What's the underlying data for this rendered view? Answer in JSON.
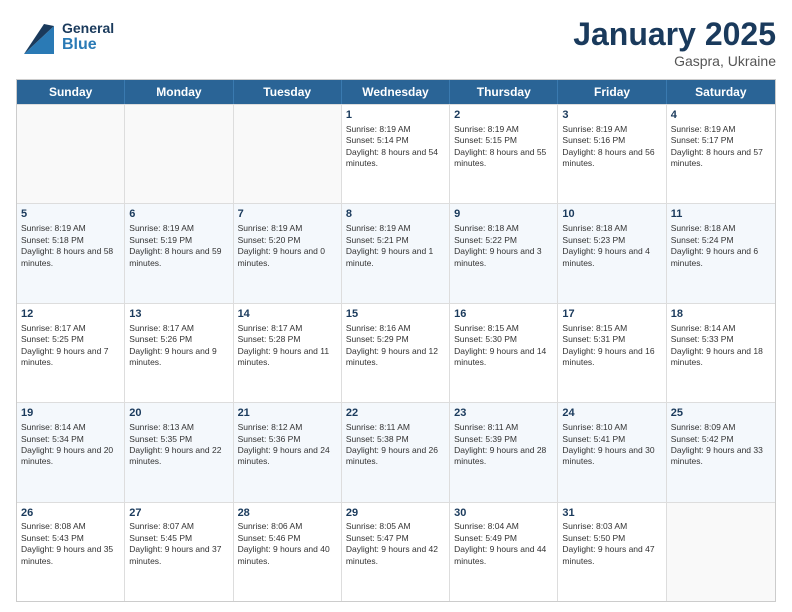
{
  "header": {
    "logo_general": "General",
    "logo_blue": "Blue",
    "month_title": "January 2025",
    "location": "Gaspra, Ukraine"
  },
  "days_of_week": [
    "Sunday",
    "Monday",
    "Tuesday",
    "Wednesday",
    "Thursday",
    "Friday",
    "Saturday"
  ],
  "weeks": [
    {
      "days": [
        {
          "number": "",
          "empty": true
        },
        {
          "number": "",
          "empty": true
        },
        {
          "number": "",
          "empty": true
        },
        {
          "number": "1",
          "sunrise": "8:19 AM",
          "sunset": "5:14 PM",
          "daylight": "8 hours and 54 minutes."
        },
        {
          "number": "2",
          "sunrise": "8:19 AM",
          "sunset": "5:15 PM",
          "daylight": "8 hours and 55 minutes."
        },
        {
          "number": "3",
          "sunrise": "8:19 AM",
          "sunset": "5:16 PM",
          "daylight": "8 hours and 56 minutes."
        },
        {
          "number": "4",
          "sunrise": "8:19 AM",
          "sunset": "5:17 PM",
          "daylight": "8 hours and 57 minutes."
        }
      ]
    },
    {
      "days": [
        {
          "number": "5",
          "sunrise": "8:19 AM",
          "sunset": "5:18 PM",
          "daylight": "8 hours and 58 minutes."
        },
        {
          "number": "6",
          "sunrise": "8:19 AM",
          "sunset": "5:19 PM",
          "daylight": "8 hours and 59 minutes."
        },
        {
          "number": "7",
          "sunrise": "8:19 AM",
          "sunset": "5:20 PM",
          "daylight": "9 hours and 0 minutes."
        },
        {
          "number": "8",
          "sunrise": "8:19 AM",
          "sunset": "5:21 PM",
          "daylight": "9 hours and 1 minute."
        },
        {
          "number": "9",
          "sunrise": "8:18 AM",
          "sunset": "5:22 PM",
          "daylight": "9 hours and 3 minutes."
        },
        {
          "number": "10",
          "sunrise": "8:18 AM",
          "sunset": "5:23 PM",
          "daylight": "9 hours and 4 minutes."
        },
        {
          "number": "11",
          "sunrise": "8:18 AM",
          "sunset": "5:24 PM",
          "daylight": "9 hours and 6 minutes."
        }
      ]
    },
    {
      "days": [
        {
          "number": "12",
          "sunrise": "8:17 AM",
          "sunset": "5:25 PM",
          "daylight": "9 hours and 7 minutes."
        },
        {
          "number": "13",
          "sunrise": "8:17 AM",
          "sunset": "5:26 PM",
          "daylight": "9 hours and 9 minutes."
        },
        {
          "number": "14",
          "sunrise": "8:17 AM",
          "sunset": "5:28 PM",
          "daylight": "9 hours and 11 minutes."
        },
        {
          "number": "15",
          "sunrise": "8:16 AM",
          "sunset": "5:29 PM",
          "daylight": "9 hours and 12 minutes."
        },
        {
          "number": "16",
          "sunrise": "8:15 AM",
          "sunset": "5:30 PM",
          "daylight": "9 hours and 14 minutes."
        },
        {
          "number": "17",
          "sunrise": "8:15 AM",
          "sunset": "5:31 PM",
          "daylight": "9 hours and 16 minutes."
        },
        {
          "number": "18",
          "sunrise": "8:14 AM",
          "sunset": "5:33 PM",
          "daylight": "9 hours and 18 minutes."
        }
      ]
    },
    {
      "days": [
        {
          "number": "19",
          "sunrise": "8:14 AM",
          "sunset": "5:34 PM",
          "daylight": "9 hours and 20 minutes."
        },
        {
          "number": "20",
          "sunrise": "8:13 AM",
          "sunset": "5:35 PM",
          "daylight": "9 hours and 22 minutes."
        },
        {
          "number": "21",
          "sunrise": "8:12 AM",
          "sunset": "5:36 PM",
          "daylight": "9 hours and 24 minutes."
        },
        {
          "number": "22",
          "sunrise": "8:11 AM",
          "sunset": "5:38 PM",
          "daylight": "9 hours and 26 minutes."
        },
        {
          "number": "23",
          "sunrise": "8:11 AM",
          "sunset": "5:39 PM",
          "daylight": "9 hours and 28 minutes."
        },
        {
          "number": "24",
          "sunrise": "8:10 AM",
          "sunset": "5:41 PM",
          "daylight": "9 hours and 30 minutes."
        },
        {
          "number": "25",
          "sunrise": "8:09 AM",
          "sunset": "5:42 PM",
          "daylight": "9 hours and 33 minutes."
        }
      ]
    },
    {
      "days": [
        {
          "number": "26",
          "sunrise": "8:08 AM",
          "sunset": "5:43 PM",
          "daylight": "9 hours and 35 minutes."
        },
        {
          "number": "27",
          "sunrise": "8:07 AM",
          "sunset": "5:45 PM",
          "daylight": "9 hours and 37 minutes."
        },
        {
          "number": "28",
          "sunrise": "8:06 AM",
          "sunset": "5:46 PM",
          "daylight": "9 hours and 40 minutes."
        },
        {
          "number": "29",
          "sunrise": "8:05 AM",
          "sunset": "5:47 PM",
          "daylight": "9 hours and 42 minutes."
        },
        {
          "number": "30",
          "sunrise": "8:04 AM",
          "sunset": "5:49 PM",
          "daylight": "9 hours and 44 minutes."
        },
        {
          "number": "31",
          "sunrise": "8:03 AM",
          "sunset": "5:50 PM",
          "daylight": "9 hours and 47 minutes."
        },
        {
          "number": "",
          "empty": true
        }
      ]
    }
  ],
  "labels": {
    "sunrise_prefix": "Sunrise: ",
    "sunset_prefix": "Sunset: ",
    "daylight_prefix": "Daylight: "
  }
}
